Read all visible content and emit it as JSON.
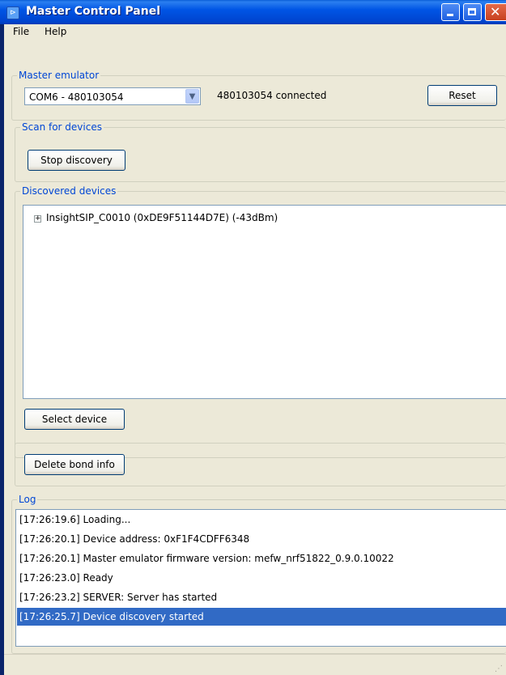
{
  "window": {
    "title": "Master Control Panel"
  },
  "menu": {
    "file": "File",
    "help": "Help"
  },
  "master_emulator": {
    "legend": "Master emulator",
    "port_selected": "COM6 - 480103054",
    "status": "480103054 connected",
    "reset_label": "Reset"
  },
  "scan": {
    "legend": "Scan for devices",
    "stop_label": "Stop discovery"
  },
  "discovered": {
    "legend": "Discovered devices",
    "devices": [
      "InsightSIP_C0010 (0xDE9F51144D7E) (-43dBm)"
    ],
    "select_label": "Select device"
  },
  "bond": {
    "delete_label": "Delete bond info"
  },
  "log": {
    "legend": "Log",
    "entries": [
      "[17:26:19.6] Loading...",
      "[17:26:20.1] Device address: 0xF1F4CDFF6348",
      "[17:26:20.1] Master emulator firmware version: mefw_nrf51822_0.9.0.10022",
      "[17:26:23.0] Ready",
      "[17:26:23.2] SERVER: Server has started",
      "[17:26:25.7] Device discovery started"
    ]
  },
  "icons": {
    "expander": "plus-box-icon",
    "dropdown": "chevron-down-icon"
  }
}
